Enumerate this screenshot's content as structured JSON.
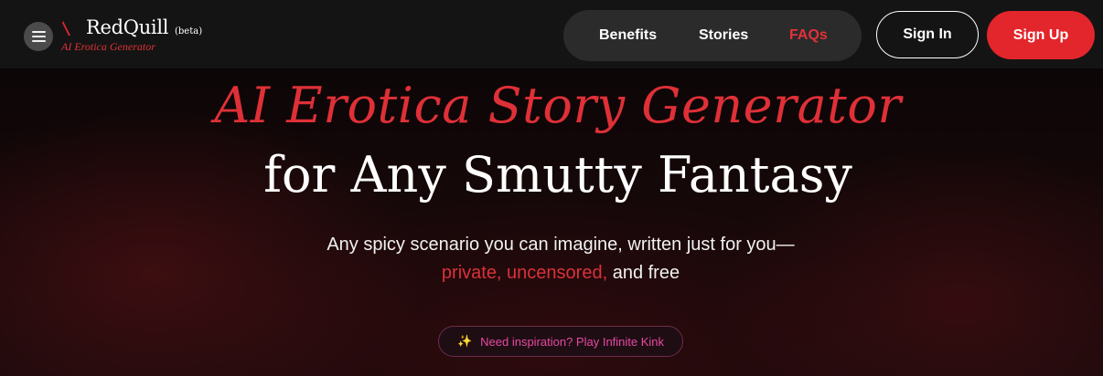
{
  "header": {
    "logo": {
      "name": "RedQuill",
      "beta": "(beta)",
      "tagline": "AI Erotica Generator"
    },
    "nav": [
      {
        "label": "Benefits",
        "active": false
      },
      {
        "label": "Stories",
        "active": false
      },
      {
        "label": "FAQs",
        "active": true
      }
    ],
    "sign_in_label": "Sign In",
    "sign_up_label": "Sign Up"
  },
  "hero": {
    "title_line1": "AI Erotica Story Generator",
    "title_line2": "for Any Smutty Fantasy",
    "subtitle_line1": "Any spicy scenario you can imagine, written just for you—",
    "subtitle_highlight": "private, uncensored,",
    "subtitle_tail": " and free",
    "inspiration_label": "Need inspiration? Play Infinite Kink",
    "inspiration_icon": "sparkles-icon"
  },
  "colors": {
    "accent_red": "#e3262c",
    "active_nav": "#e0323a",
    "topbar": "#141414",
    "nav_pill": "#2b2b2b",
    "inspiration_text": "#e64aa0"
  }
}
